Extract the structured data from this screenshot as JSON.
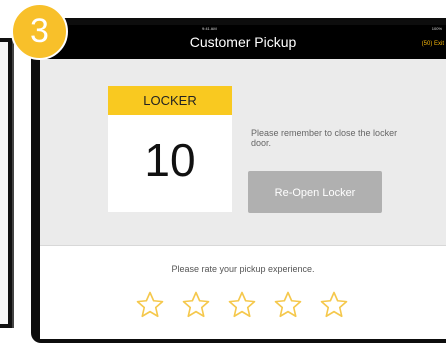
{
  "step_badge": "3",
  "status": {
    "time": "9:41 AM",
    "battery": "100%"
  },
  "header": {
    "title": "Customer Pickup",
    "exit_label": "(50) Exit"
  },
  "locker": {
    "label": "LOCKER",
    "number": "10"
  },
  "reminder": "Please remember to close the locker door.",
  "reopen_button": "Re-Open Locker",
  "rating": {
    "prompt": "Please rate your pickup experience.",
    "star_count": 5
  },
  "colors": {
    "accent": "#f9c920",
    "exit": "#f5b60a",
    "star": "#f5c84c",
    "button": "#b0b0b0"
  }
}
